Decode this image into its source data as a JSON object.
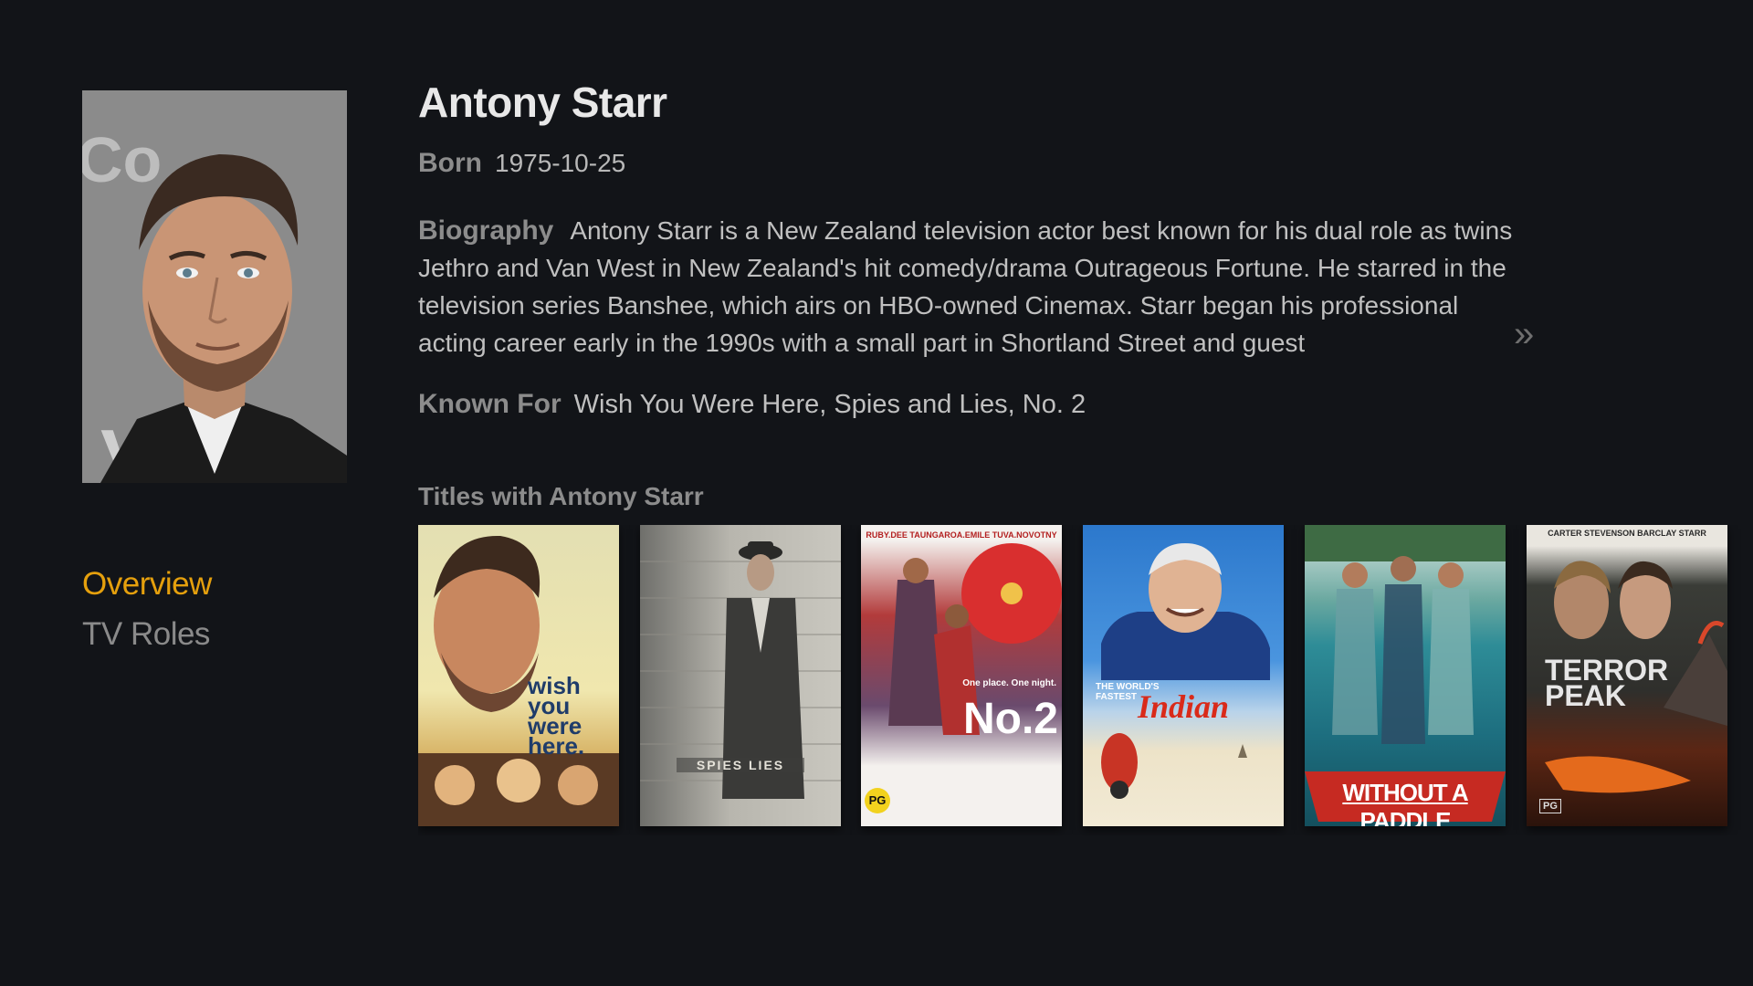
{
  "actor": {
    "name": "Antony Starr",
    "born_label": "Born",
    "born_value": "1975-10-25",
    "bio_label": "Biography",
    "bio_text": "Antony Starr is a New Zealand television actor best known for his dual role as twins Jethro and Van West in New Zealand's hit comedy/drama Outrageous Fortune. He starred in the television series Banshee, which airs on HBO-owned Cinemax.   Starr began his professional acting career early in the 1990s with a small part in Shortland Street and guest",
    "more_glyph": "»",
    "known_label": "Known For",
    "known_value": "Wish You Were Here, Spies and Lies, No. 2"
  },
  "nav": {
    "items": [
      {
        "label": "Overview",
        "active": true
      },
      {
        "label": "TV Roles",
        "active": false
      }
    ]
  },
  "titles": {
    "heading": "Titles with Antony Starr",
    "posters": [
      {
        "text": "wish you were here."
      },
      {
        "text": "SPIES LIES"
      },
      {
        "top_names": "RUBY.DEE   TAUNGAROA.EMILE   TUVA.NOVOTNY",
        "tagline": "One place. One night.",
        "text": "No.2",
        "rating": "PG"
      },
      {
        "top": "THE WORLD'S FASTEST",
        "text": "Indian"
      },
      {
        "text": "WITHOUT A PADDLE"
      },
      {
        "top_names": "CARTER   STEVENSON   BARCLAY   STARR",
        "text": "TERROR PEAK",
        "rating": "PG"
      }
    ]
  },
  "colors": {
    "background": "#121418",
    "accent": "#e5a00d",
    "label": "#8c8c8c",
    "text": "#c0c0c0"
  }
}
